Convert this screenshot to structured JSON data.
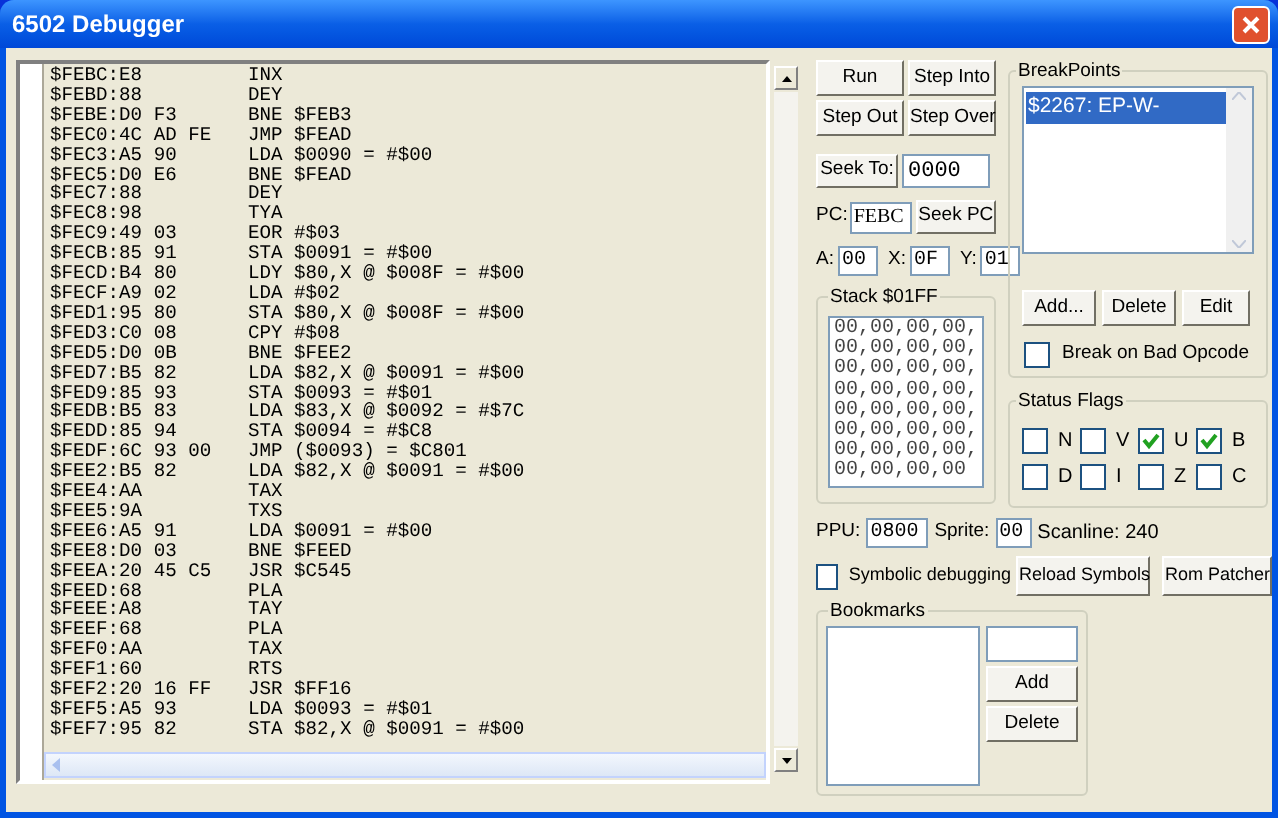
{
  "window": {
    "title": "6502 Debugger"
  },
  "disassembly": [
    {
      "code": "$FEBC:E8",
      "instruction": "INX"
    },
    {
      "code": "$FEBD:88",
      "instruction": "DEY"
    },
    {
      "code": "$FEBE:D0 F3",
      "instruction": "BNE $FEB3"
    },
    {
      "code": "$FEC0:4C AD FE",
      "instruction": "JMP $FEAD"
    },
    {
      "code": "$FEC3:A5 90",
      "instruction": "LDA $0090 = #$00"
    },
    {
      "code": "$FEC5:D0 E6",
      "instruction": "BNE $FEAD"
    },
    {
      "code": "$FEC7:88",
      "instruction": "DEY"
    },
    {
      "code": "$FEC8:98",
      "instruction": "TYA"
    },
    {
      "code": "$FEC9:49 03",
      "instruction": "EOR #$03"
    },
    {
      "code": "$FECB:85 91",
      "instruction": "STA $0091 = #$00"
    },
    {
      "code": "$FECD:B4 80",
      "instruction": "LDY $80,X @ $008F = #$00"
    },
    {
      "code": "$FECF:A9 02",
      "instruction": "LDA #$02"
    },
    {
      "code": "$FED1:95 80",
      "instruction": "STA $80,X @ $008F = #$00"
    },
    {
      "code": "$FED3:C0 08",
      "instruction": "CPY #$08"
    },
    {
      "code": "$FED5:D0 0B",
      "instruction": "BNE $FEE2"
    },
    {
      "code": "$FED7:B5 82",
      "instruction": "LDA $82,X @ $0091 = #$00"
    },
    {
      "code": "$FED9:85 93",
      "instruction": "STA $0093 = #$01"
    },
    {
      "code": "$FEDB:B5 83",
      "instruction": "LDA $83,X @ $0092 = #$7C"
    },
    {
      "code": "$FEDD:85 94",
      "instruction": "STA $0094 = #$C8"
    },
    {
      "code": "$FEDF:6C 93 00",
      "instruction": "JMP ($0093) = $C801"
    },
    {
      "code": "$FEE2:B5 82",
      "instruction": "LDA $82,X @ $0091 = #$00"
    },
    {
      "code": "$FEE4:AA",
      "instruction": "TAX"
    },
    {
      "code": "$FEE5:9A",
      "instruction": "TXS"
    },
    {
      "code": "$FEE6:A5 91",
      "instruction": "LDA $0091 = #$00"
    },
    {
      "code": "$FEE8:D0 03",
      "instruction": "BNE $FEED"
    },
    {
      "code": "$FEEA:20 45 C5",
      "instruction": "JSR $C545"
    },
    {
      "code": "$FEED:68",
      "instruction": "PLA"
    },
    {
      "code": "$FEEE:A8",
      "instruction": "TAY"
    },
    {
      "code": "$FEEF:68",
      "instruction": "PLA"
    },
    {
      "code": "$FEF0:AA",
      "instruction": "TAX"
    },
    {
      "code": "$FEF1:60",
      "instruction": "RTS"
    },
    {
      "code": "$FEF2:20 16 FF",
      "instruction": "JSR $FF16"
    },
    {
      "code": "$FEF5:A5 93",
      "instruction": "LDA $0093 = #$01"
    },
    {
      "code": "$FEF7:95 82",
      "instruction": "STA $82,X @ $0091 = #$00"
    }
  ],
  "step_buttons": [
    "Run",
    "Step Into",
    "Step Out",
    "Step Over"
  ],
  "seek_to": {
    "button": "Seek To:",
    "value": "0000"
  },
  "pc": {
    "label": "PC:",
    "value": "FEBC",
    "button": "Seek PC"
  },
  "registers": [
    {
      "label": "A:",
      "value": "00"
    },
    {
      "label": "X:",
      "value": "0F"
    },
    {
      "label": "Y:",
      "value": "01"
    }
  ],
  "stack": {
    "title": "Stack $01FF",
    "lines": [
      "00,00,00,00,",
      "00,00,00,00,",
      "00,00,00,00,",
      "00,00,00,00,",
      "00,00,00,00,",
      "00,00,00,00,",
      "00,00,00,00,",
      "00,00,00,00"
    ]
  },
  "breakpoints": {
    "title": "BreakPoints",
    "items": [
      {
        "label": "$2267: EP-W-",
        "selected": true
      }
    ],
    "buttons": [
      "Add...",
      "Delete",
      "Edit"
    ],
    "break_on_bad_opcode": {
      "label": "Break on Bad Opcode",
      "checked": false
    }
  },
  "status_flags": {
    "title": "Status Flags",
    "flags": [
      {
        "label": "N",
        "checked": false
      },
      {
        "label": "V",
        "checked": false
      },
      {
        "label": "U",
        "checked": true
      },
      {
        "label": "B",
        "checked": true
      },
      {
        "label": "D",
        "checked": false
      },
      {
        "label": "I",
        "checked": false
      },
      {
        "label": "Z",
        "checked": false
      },
      {
        "label": "C",
        "checked": false
      }
    ]
  },
  "ppu": {
    "label": "PPU:",
    "value": "0800"
  },
  "sprite": {
    "label": "Sprite:",
    "value": "00"
  },
  "scanline": "Scanline: 240",
  "symbolic_debugging": {
    "label": "Symbolic debugging",
    "checked": false
  },
  "reload_symbols": "Reload Symbols",
  "rom_patcher": "Rom Patcher",
  "bookmarks": {
    "title": "Bookmarks",
    "buttons": [
      "Add",
      "Delete"
    ]
  }
}
